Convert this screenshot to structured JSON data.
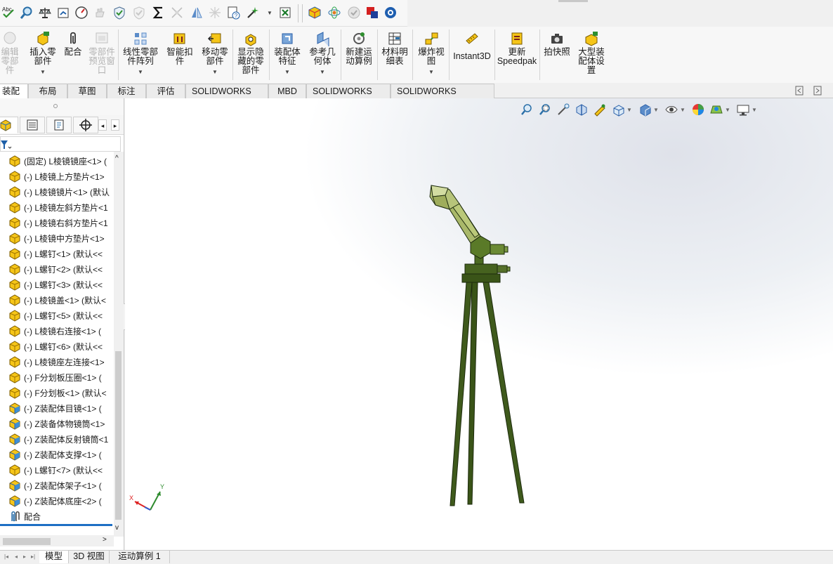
{
  "quickbar": {
    "icons": [
      "spelling-abc-icon",
      "magnify-icon",
      "balance-scale-icon",
      "folder-open-icon",
      "gauge-icon",
      "hand-disabled-icon",
      "shield-check-icon",
      "shield-disabled-icon",
      "sigma-icon",
      "triad-disabled-icon",
      "mirror-icon",
      "sparkle-disabled-icon",
      "question-doc-icon",
      "wand-icon",
      "excel-x-icon",
      "color-cube-icon",
      "color-atom-icon",
      "check-gray-icon",
      "red-blue-square-icon",
      "blue-gear-icon"
    ],
    "spelling_label": "Abc"
  },
  "ribbon": {
    "buttons": [
      {
        "label": "编辑零部件",
        "icon": "edit-component-icon",
        "disabled": true
      },
      {
        "label": "插入零部件",
        "icon": "insert-component-icon",
        "disabled": false
      },
      {
        "label": "配合",
        "icon": "paperclip-mate-icon",
        "disabled": false
      },
      {
        "label": "零部件预览窗口",
        "icon": "component-preview-icon",
        "disabled": true
      },
      {
        "label": "线性零部件阵列",
        "icon": "linear-pattern-icon",
        "disabled": false
      },
      {
        "label": "智能扣件",
        "icon": "smart-fastener-icon",
        "disabled": false
      },
      {
        "label": "移动零部件",
        "icon": "move-component-icon",
        "disabled": false
      },
      {
        "label": "显示隐藏的零部件",
        "icon": "show-hidden-icon",
        "disabled": false
      },
      {
        "label": "装配体特征",
        "icon": "assembly-feature-icon",
        "disabled": false
      },
      {
        "label": "参考几何体",
        "icon": "reference-geometry-icon",
        "disabled": false
      },
      {
        "label": "新建运动算例",
        "icon": "motion-study-icon",
        "disabled": false
      },
      {
        "label": "材料明细表",
        "icon": "bom-icon",
        "disabled": false
      },
      {
        "label": "爆炸视图",
        "icon": "exploded-view-icon",
        "disabled": false
      },
      {
        "label": "Instant3D",
        "icon": "instant3d-icon",
        "disabled": false
      },
      {
        "label": "更新Speedpak",
        "icon": "speedpak-icon",
        "disabled": false
      },
      {
        "label": "拍快照",
        "icon": "camera-icon",
        "disabled": false
      },
      {
        "label": "大型装配体设置",
        "icon": "large-assembly-icon",
        "disabled": false
      }
    ]
  },
  "tabs": [
    {
      "label": "装配体",
      "active": true
    },
    {
      "label": "布局",
      "active": false
    },
    {
      "label": "草图",
      "active": false
    },
    {
      "label": "标注",
      "active": false
    },
    {
      "label": "评估",
      "active": false
    },
    {
      "label": "SOLIDWORKS 插件",
      "active": false
    },
    {
      "label": "MBD",
      "active": false
    },
    {
      "label": "SOLIDWORKS CAM",
      "active": false
    },
    {
      "label": "SOLIDWORKS Inspection",
      "active": false
    }
  ],
  "panel": {
    "tabs": [
      "feature-manager-icon",
      "property-manager-icon",
      "configuration-manager-icon",
      "dimxpert-icon"
    ],
    "filter_icon": "filter-icon",
    "tree": [
      {
        "text": "(固定) L棱镜镜座<1> (",
        "type": "part"
      },
      {
        "text": "(-) L棱镜上方垫片<1>",
        "type": "part"
      },
      {
        "text": "(-) L棱镜镜片<1> (默认",
        "type": "part"
      },
      {
        "text": "(-) L棱镜左斜方垫片<1",
        "type": "part"
      },
      {
        "text": "(-) L棱镜右斜方垫片<1",
        "type": "part"
      },
      {
        "text": "(-) L棱镜中方垫片<1>",
        "type": "part"
      },
      {
        "text": "(-) L螺钉<1> (默认<<",
        "type": "part"
      },
      {
        "text": "(-) L螺钉<2> (默认<<",
        "type": "part"
      },
      {
        "text": "(-) L螺钉<3> (默认<<",
        "type": "part"
      },
      {
        "text": "(-) L棱镜盖<1> (默认<",
        "type": "part"
      },
      {
        "text": "(-) L螺钉<5> (默认<<",
        "type": "part"
      },
      {
        "text": "(-) L棱镜右连接<1> (",
        "type": "part"
      },
      {
        "text": "(-) L螺钉<6> (默认<<",
        "type": "part"
      },
      {
        "text": "(-) L棱镜座左连接<1>",
        "type": "part"
      },
      {
        "text": "(-) F分划板压圈<1> (",
        "type": "part"
      },
      {
        "text": "(-) F分划板<1> (默认<",
        "type": "part"
      },
      {
        "text": "(-) Z装配体目镜<1> (",
        "type": "assembly"
      },
      {
        "text": "(-) Z装备体物镜筒<1>",
        "type": "assembly"
      },
      {
        "text": "(-) Z装配体反射镜筒<1",
        "type": "assembly"
      },
      {
        "text": "(-) Z装配体支撑<1> (",
        "type": "assembly"
      },
      {
        "text": "(-) L螺钉<7> (默认<<",
        "type": "part"
      },
      {
        "text": "(-) Z装配体架子<1> (",
        "type": "assembly"
      },
      {
        "text": "(-) Z装配体底座<2> (",
        "type": "assembly"
      },
      {
        "text": "配合",
        "type": "mates"
      }
    ]
  },
  "viewport": {
    "hud_icons": [
      "zoom-to-fit-icon",
      "zoom-area-icon",
      "previous-view-icon",
      "section-view-icon",
      "dynamic-annotation-icon",
      "view-orientation-icon",
      "display-style-icon",
      "hide-show-icon",
      "edit-appearance-icon",
      "apply-scene-icon",
      "view-settings-icon"
    ],
    "triad": {
      "x_label": "X",
      "y_label": "Y"
    },
    "model_color": "#3f5a1c"
  },
  "bottom_tabs": [
    {
      "label": "模型",
      "active": true
    },
    {
      "label": "3D 视图",
      "active": false
    },
    {
      "label": "运动算例 1",
      "active": false
    }
  ]
}
